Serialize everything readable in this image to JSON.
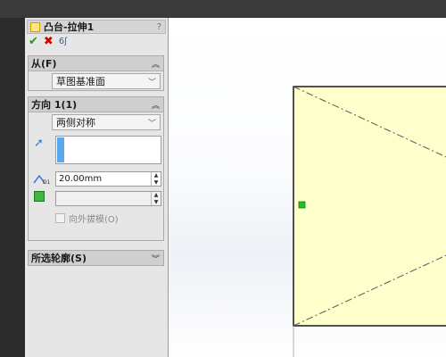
{
  "property_manager": {
    "title": "凸台-拉伸1",
    "help_label": "?",
    "actions": {
      "ok": "✔",
      "cancel": "✖",
      "detail": "6ʃ"
    }
  },
  "from_group": {
    "title": "从(F)",
    "collapse_glyph": "︽",
    "start_condition": "草图基准面"
  },
  "direction1_group": {
    "title": "方向 1(1)",
    "collapse_glyph": "︽",
    "end_condition": "两侧对称",
    "depth_value": "20.00mm",
    "depth_icon_label": "D1",
    "draft_value": "",
    "draft_outward_label": "向外拔模(O)"
  },
  "selected_contours_group": {
    "title": "所选轮廓(S)",
    "expand_glyph": "︾"
  },
  "colors": {
    "sketch_fill": "#ffffcc",
    "sketch_edge": "#1a1a1a",
    "handle": "#22c022",
    "panel_bg": "#e6e6e6"
  }
}
